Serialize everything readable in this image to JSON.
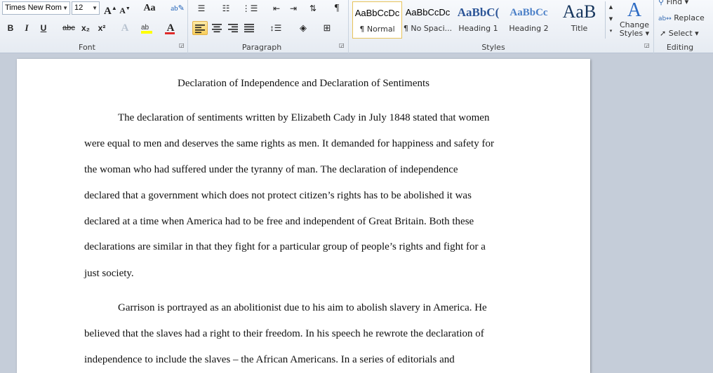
{
  "ribbon": {
    "font": {
      "name": "Times New Rom",
      "size": "12",
      "grow_label": "A",
      "shrink_label": "A",
      "change_case_label": "Aa",
      "bold": "B",
      "italic": "I",
      "underline": "U",
      "strike": "abc",
      "subscript": "x₂",
      "superscript": "x²",
      "font_color": "A",
      "group_label": "Font"
    },
    "paragraph": {
      "group_label": "Paragraph"
    },
    "styles": {
      "group_label": "Styles",
      "items": [
        {
          "preview": "AaBbCcDc",
          "name": "¶ Normal"
        },
        {
          "preview": "AaBbCcDc",
          "name": "¶ No Spaci..."
        },
        {
          "preview": "AaBbC(",
          "name": "Heading 1"
        },
        {
          "preview": "AaBbCc",
          "name": "Heading 2"
        },
        {
          "preview": "AaB",
          "name": "Title"
        }
      ],
      "change_styles_line1": "Change",
      "change_styles_line2": "Styles ▾"
    },
    "editing": {
      "group_label": "Editing",
      "find": "Find ▾",
      "replace": "Replace",
      "select": "Select ▾"
    }
  },
  "document": {
    "title": "Declaration of Independence and Declaration of Sentiments",
    "lines": [
      "The declaration of sentiments written by Elizabeth Cady in July 1848 stated that women",
      "were equal to men and deserves the same rights as men. It demanded for happiness and safety for",
      "the woman who had suffered under the tyranny of man. The declaration of independence",
      "declared that a government which does not protect citizen’s rights has to be abolished it was",
      "declared at a time when America had to be free and independent of Great Britain. Both these",
      "declarations are similar in that they fight for a particular group of people’s rights and fight for a",
      "just society.",
      "Garrison is portrayed as an abolitionist  due to his aim to abolish slavery in America. He",
      "believed that the slaves had a right to their freedom. In his speech he rewrote the declaration of",
      "independence to include the slaves – the African Americans. In a series  of editorials and"
    ]
  }
}
